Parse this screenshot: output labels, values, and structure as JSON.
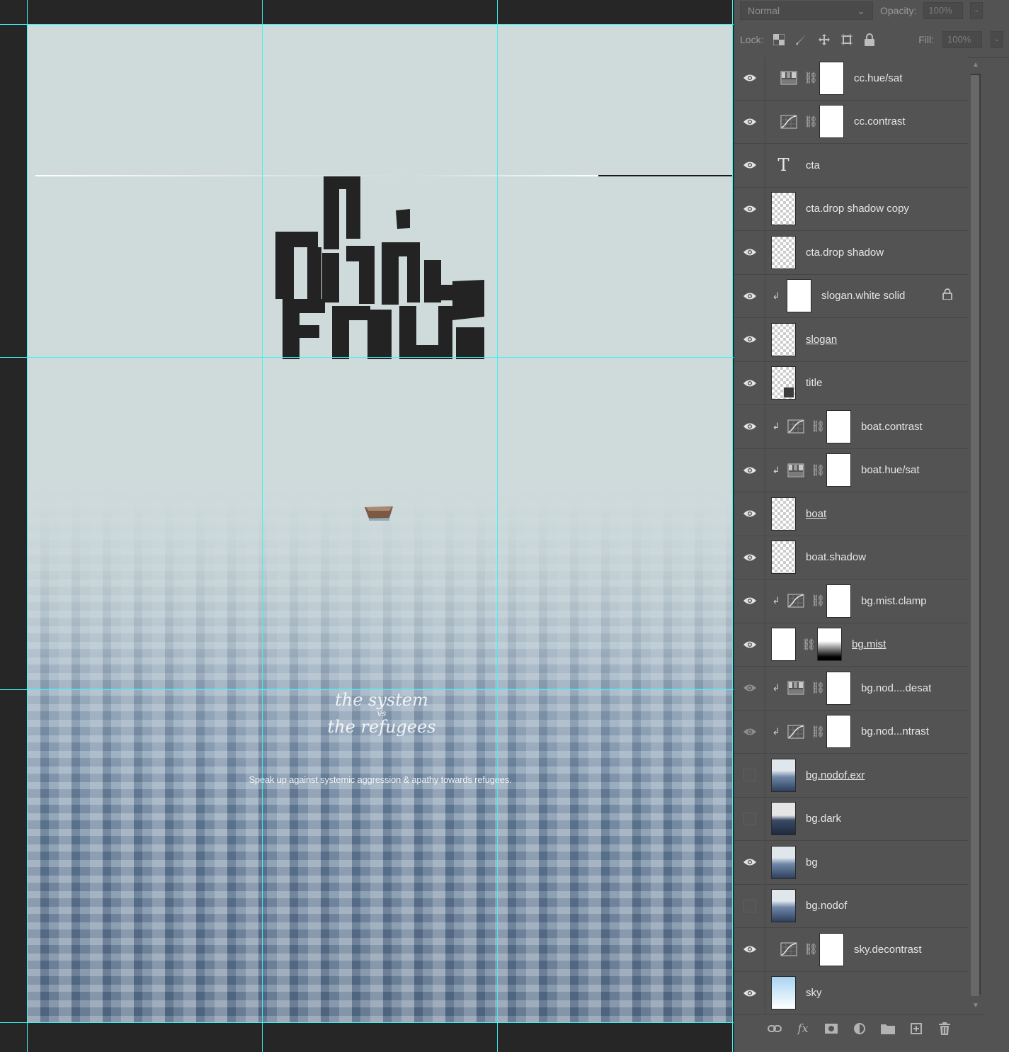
{
  "canvas": {
    "cta_text": "Speak up against systemic aggression & apathy towards refugees.",
    "slogan_line1": "the system",
    "slogan_vs": "vs",
    "slogan_line2": "the refugees"
  },
  "panel": {
    "blend_mode": "Normal",
    "opacity_label": "Opacity:",
    "opacity_value": "100%",
    "lock_label": "Lock:",
    "fill_label": "Fill:",
    "fill_value": "100%"
  },
  "layers": [
    {
      "name": "cc.hue/sat",
      "visible": true,
      "type": "hue-sat",
      "mask": true
    },
    {
      "name": "cc.contrast",
      "visible": true,
      "type": "curves",
      "mask": true
    },
    {
      "name": "cta",
      "visible": true,
      "type": "text"
    },
    {
      "name": "cta.drop shadow copy",
      "visible": true,
      "type": "checker"
    },
    {
      "name": "cta.drop shadow",
      "visible": true,
      "type": "checker"
    },
    {
      "name": "slogan.white solid",
      "visible": true,
      "type": "white",
      "clipped": true,
      "locked": true
    },
    {
      "name": "slogan",
      "visible": true,
      "type": "checker",
      "underline": true
    },
    {
      "name": "title",
      "visible": true,
      "type": "smart"
    },
    {
      "name": "boat.contrast",
      "visible": true,
      "type": "curves",
      "mask": true,
      "clipped": true
    },
    {
      "name": "boat.hue/sat",
      "visible": true,
      "type": "hue-sat",
      "mask": true,
      "clipped": true
    },
    {
      "name": "boat",
      "visible": true,
      "type": "checker",
      "underline": true
    },
    {
      "name": "boat.shadow",
      "visible": true,
      "type": "checker"
    },
    {
      "name": "bg.mist.clamp",
      "visible": true,
      "type": "curves",
      "mask": true,
      "clipped": true
    },
    {
      "name": "bg.mist",
      "visible": true,
      "type": "mist",
      "underline": true
    },
    {
      "name": "bg.nod....desat",
      "visible": true,
      "dim": true,
      "type": "hue-sat",
      "mask": true,
      "clipped": true
    },
    {
      "name": "bg.nod...ntrast",
      "visible": true,
      "dim": true,
      "type": "curves",
      "mask": true,
      "clipped": true
    },
    {
      "name": "bg.nodof.exr",
      "visible": false,
      "type": "photo",
      "underline": true
    },
    {
      "name": "bg.dark",
      "visible": false,
      "type": "photo-dark"
    },
    {
      "name": "bg",
      "visible": true,
      "type": "photo"
    },
    {
      "name": "bg.nodof",
      "visible": false,
      "type": "photo"
    },
    {
      "name": "sky.decontrast",
      "visible": true,
      "type": "curves",
      "mask": true
    },
    {
      "name": "sky",
      "visible": true,
      "type": "sky"
    }
  ],
  "colors": {
    "guide": "#3ff2f2",
    "panel_bg": "#535353",
    "canvas_bg": "#262626"
  },
  "icons": {
    "bottom_bar": [
      "link-layers-icon",
      "fx-icon",
      "add-mask-icon",
      "adjustment-layer-icon",
      "new-group-icon",
      "new-layer-icon",
      "trash-icon"
    ]
  }
}
